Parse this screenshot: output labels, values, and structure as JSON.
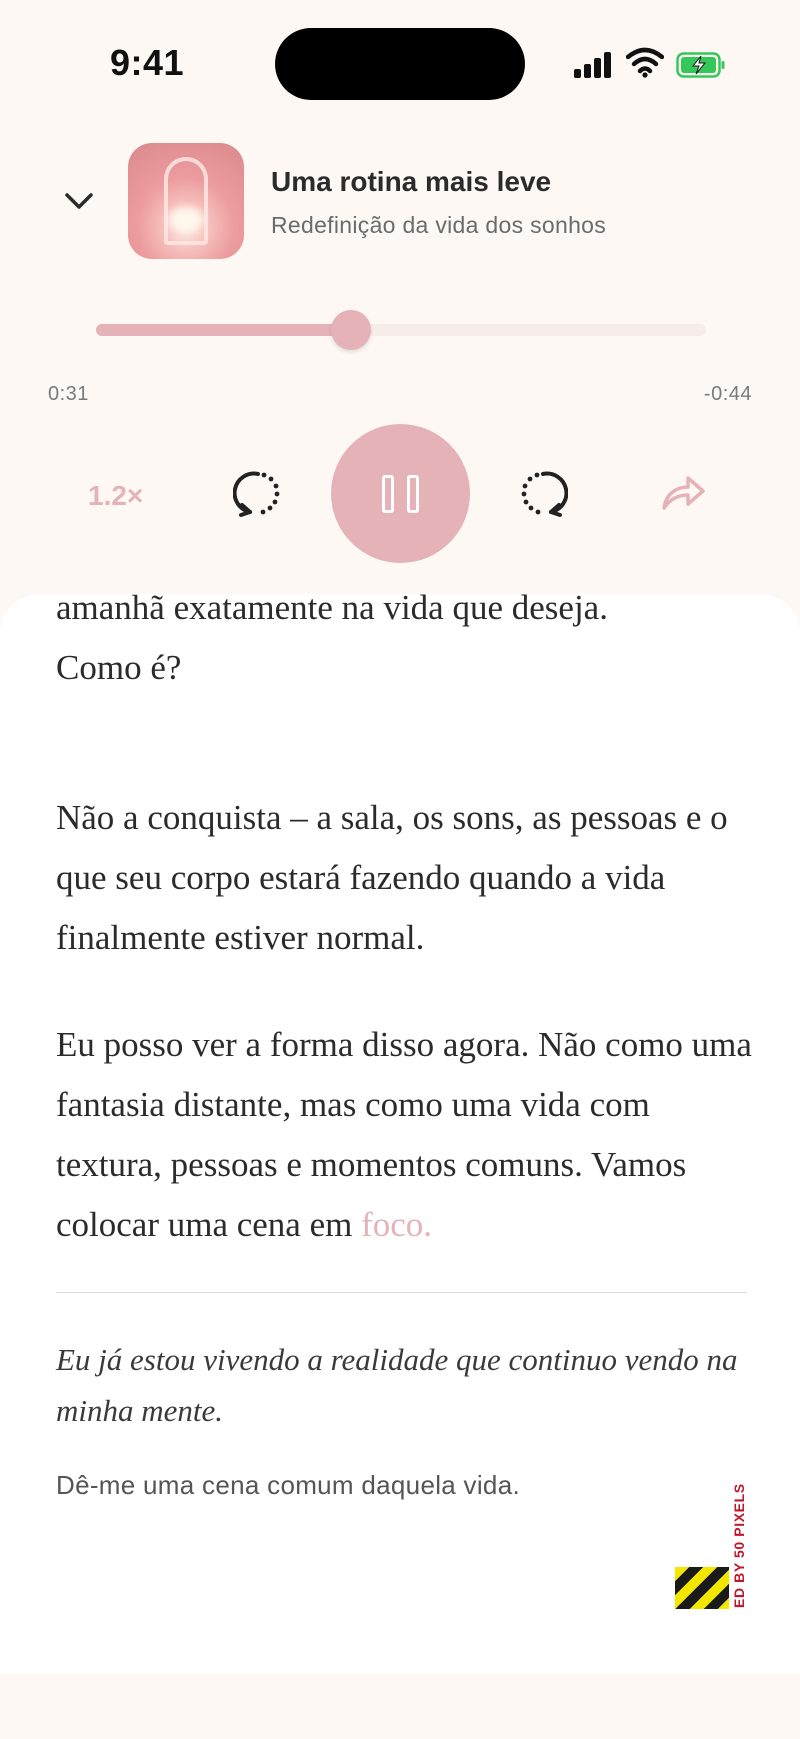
{
  "status_bar": {
    "time": "9:41",
    "icons": [
      "signal-icon",
      "wifi-icon",
      "battery-charging-icon"
    ]
  },
  "player": {
    "collapse_icon": "chevron-down-icon",
    "title": "Uma rotina mais leve",
    "subtitle": "Redefinição da vida dos sonhos",
    "progress": 0.42,
    "time_elapsed": "0:31",
    "time_remaining": "-0:44",
    "speed_label": "1.2×",
    "controls": [
      "rewind-icon",
      "pause-icon",
      "forward-icon",
      "share-icon"
    ]
  },
  "reader": {
    "paragraph_0_line_1": "amanhã exatamente na vida que deseja.",
    "paragraph_0_line_2": "Como é?",
    "paragraph_1": "Não a conquista – a sala, os sons, as pessoas e o que seu corpo estará fazendo quando a vida finalmente estiver normal.",
    "paragraph_2_main": "Eu posso ver a forma disso agora. Não como uma fantasia distante, mas como uma vida com textura, pessoas e momentos comuns. Vamos colocar uma cena em",
    "paragraph_2_highlight": "foco.",
    "affirmation": "Eu já estou vivendo a realidade que continuo vendo na minha mente.",
    "prompt": "Dê-me uma cena comum daquela vida."
  },
  "watermark": {
    "text": "ED BY 50 PIXELS"
  },
  "colors": {
    "accent": "#e5b2b8",
    "background": "#fdf8f4",
    "card": "#ffffff",
    "text": "#2b2b2b"
  }
}
